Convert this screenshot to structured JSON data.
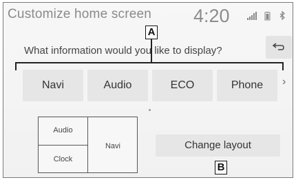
{
  "header": {
    "title": "Customize home screen",
    "time": "4:20",
    "status_icons": [
      "signal-icon",
      "battery-icon",
      "bluetooth-icon"
    ]
  },
  "question": "What information would you like to display?",
  "callouts": {
    "a": "A",
    "b": "B"
  },
  "options": [
    "Navi",
    "Audio",
    "ECO",
    "Phone"
  ],
  "layout_preview": {
    "top_left": "Audio",
    "bottom_left": "Clock",
    "right": "Navi"
  },
  "change_layout_label": "Change layout"
}
